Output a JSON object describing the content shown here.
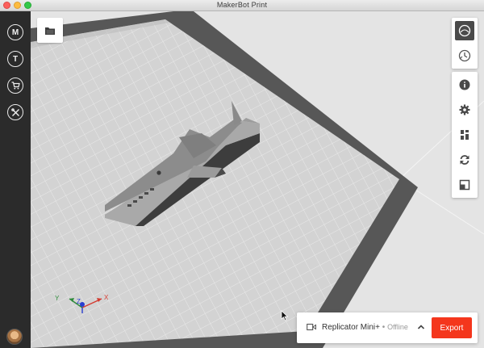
{
  "window": {
    "title": "MakerBot Print"
  },
  "sidebar": {
    "items": [
      {
        "icon": "makerbot-logo-icon",
        "glyph": "M"
      },
      {
        "icon": "thingiverse-icon",
        "glyph": "T"
      },
      {
        "icon": "cart-icon"
      },
      {
        "icon": "tools-icon"
      }
    ]
  },
  "toolbar": {
    "open_icon": "folder-icon"
  },
  "right_panel": {
    "view_buttons": [
      "view-icon",
      "print-preview-icon"
    ],
    "tools": [
      "info-icon",
      "settings-icon",
      "arrange-icon",
      "rotate-icon",
      "scale-icon"
    ]
  },
  "axes": {
    "x": "X",
    "y": "Y",
    "z": "Z"
  },
  "printer_bar": {
    "printer_name": "Replicator Mini+",
    "separator": "•",
    "status": "Offline",
    "export_label": "Export"
  },
  "colors": {
    "accent": "#f4361c",
    "sidebar": "#2b2b2b",
    "plate": "#d2d2d2",
    "plate_border": "#575757"
  }
}
